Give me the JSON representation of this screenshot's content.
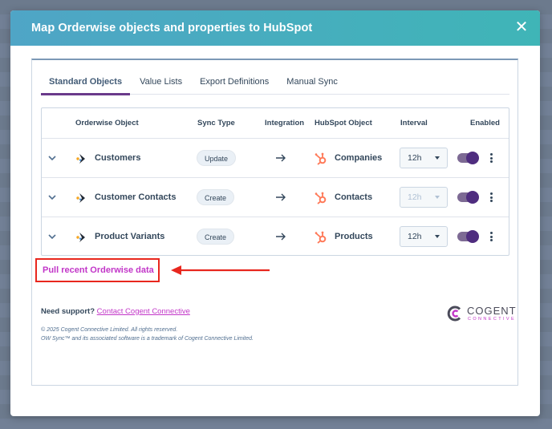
{
  "modal": {
    "title": "Map Orderwise objects and properties to HubSpot",
    "close_label": "✕"
  },
  "tabs": [
    {
      "label": "Standard Objects",
      "active": true
    },
    {
      "label": "Value Lists",
      "active": false
    },
    {
      "label": "Export Definitions",
      "active": false
    },
    {
      "label": "Manual Sync",
      "active": false
    }
  ],
  "table": {
    "headers": {
      "orderwise_object": "Orderwise Object",
      "sync_type": "Sync Type",
      "integration": "Integration",
      "hubspot_object": "HubSpot Object",
      "interval": "Interval",
      "enabled": "Enabled"
    },
    "rows": [
      {
        "orderwise_object": "Customers",
        "sync_type": "Update",
        "hubspot_object": "Companies",
        "interval": "12h",
        "interval_disabled": false,
        "enabled": true
      },
      {
        "orderwise_object": "Customer Contacts",
        "sync_type": "Create",
        "hubspot_object": "Contacts",
        "interval": "12h",
        "interval_disabled": true,
        "enabled": true
      },
      {
        "orderwise_object": "Product Variants",
        "sync_type": "Create",
        "hubspot_object": "Products",
        "interval": "12h",
        "interval_disabled": false,
        "enabled": true
      }
    ]
  },
  "pull_link": "Pull recent Orderwise data",
  "support": {
    "prefix": "Need support?",
    "link": "Contact Cogent Connective"
  },
  "legal": {
    "line1": "© 2025 Cogent Connective Limited. All rights reserved.",
    "line2": "OW Sync™ and its associated software is a trademark of Cogent Connective Limited."
  },
  "brand": {
    "name": "COGENT",
    "sub": "CONNECTIVE"
  },
  "colors": {
    "header_gradient_start": "#4fa5c6",
    "header_gradient_end": "#3fb5b7",
    "accent_purple": "#4f2d7f",
    "link_magenta": "#c236c8",
    "annotation_red": "#e8271e",
    "hubspot_orange": "#ff7a59"
  }
}
